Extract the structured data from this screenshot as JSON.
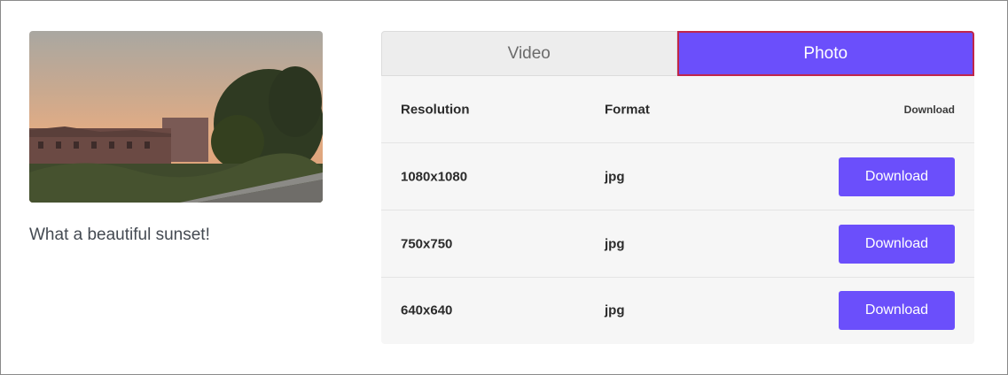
{
  "media": {
    "image_description_icon": "sunset-photo",
    "caption": "What a beautiful sunset!"
  },
  "tabs": [
    {
      "label": "Video",
      "active": false
    },
    {
      "label": "Photo",
      "active": true
    }
  ],
  "table": {
    "headers": {
      "resolution": "Resolution",
      "format": "Format",
      "download": "Download"
    },
    "rows": [
      {
        "resolution": "1080x1080",
        "format": "jpg",
        "action": "Download"
      },
      {
        "resolution": "750x750",
        "format": "jpg",
        "action": "Download"
      },
      {
        "resolution": "640x640",
        "format": "jpg",
        "action": "Download"
      }
    ]
  },
  "colors": {
    "accent": "#6b4ffb",
    "active_tab_border": "#c0264a",
    "panel_bg": "#f6f6f6"
  }
}
